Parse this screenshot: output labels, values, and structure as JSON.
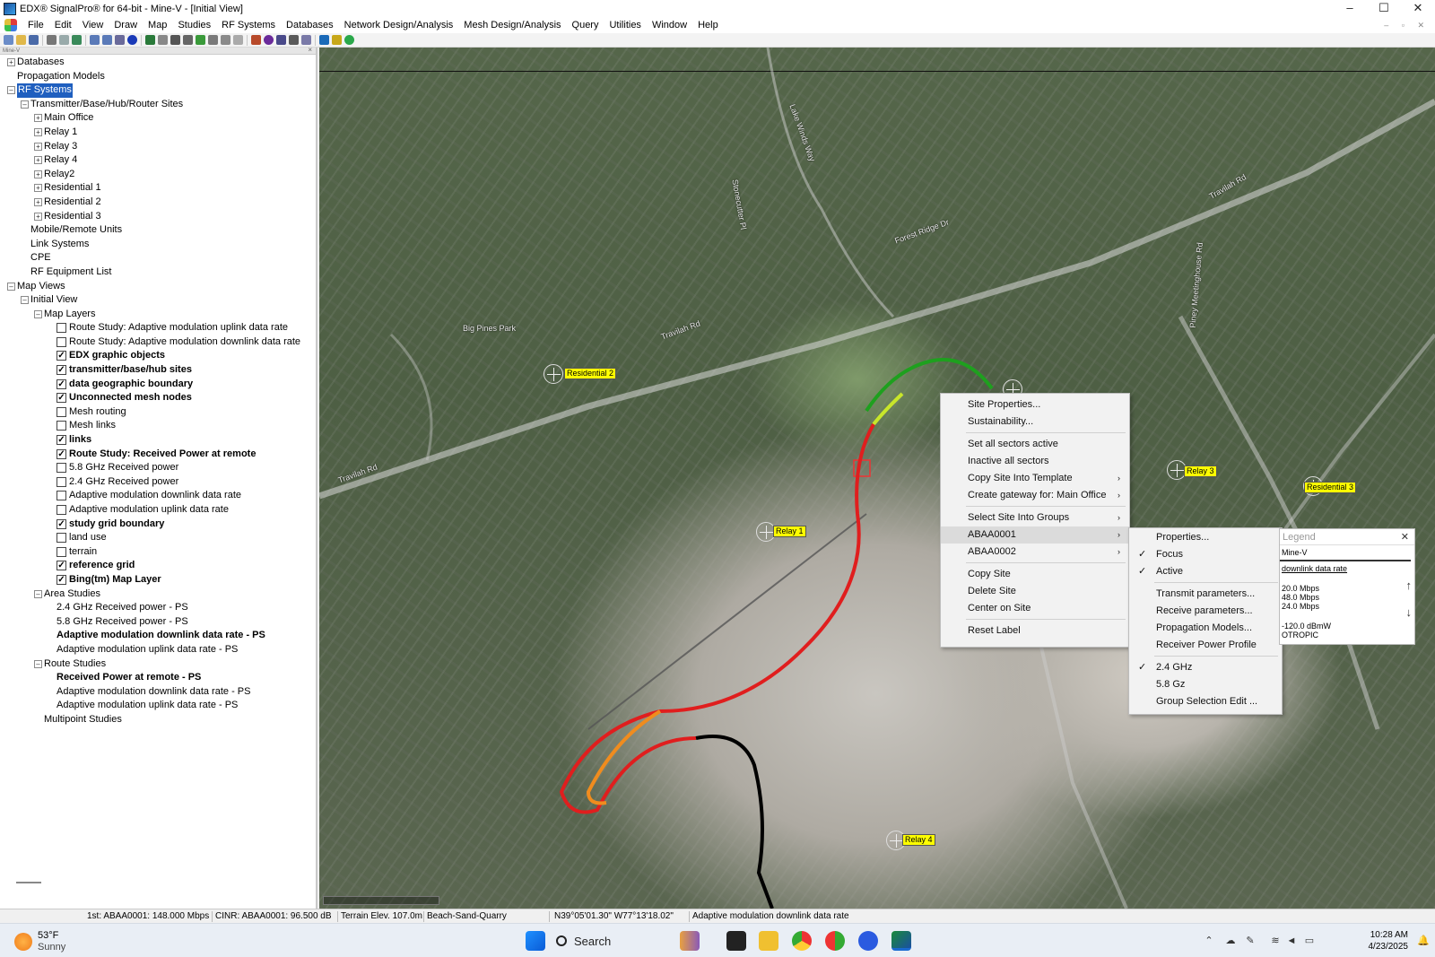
{
  "window": {
    "title": "EDX® SignalPro®  for 64-bit - Mine-V - [Initial View]",
    "controls": [
      "–",
      "☐",
      "✕"
    ]
  },
  "menubar": {
    "items": [
      "File",
      "Edit",
      "View",
      "Draw",
      "Map",
      "Studies",
      "RF Systems",
      "Databases",
      "Network Design/Analysis",
      "Mesh Design/Analysis",
      "Query",
      "Utilities",
      "Window",
      "Help"
    ]
  },
  "left_panel": {
    "header": "Mine-V",
    "close": "×",
    "tree": [
      {
        "label": "Databases",
        "indent": 0,
        "exp": "+"
      },
      {
        "label": "Propagation Models",
        "indent": 0
      },
      {
        "label": "RF Systems",
        "indent": 0,
        "exp": "–",
        "selected": true
      },
      {
        "label": "Transmitter/Base/Hub/Router Sites",
        "indent": 1,
        "exp": "–"
      },
      {
        "label": "Main Office",
        "indent": 2,
        "exp": "+"
      },
      {
        "label": "Relay 1",
        "indent": 2,
        "exp": "+"
      },
      {
        "label": "Relay 3",
        "indent": 2,
        "exp": "+"
      },
      {
        "label": "Relay 4",
        "indent": 2,
        "exp": "+"
      },
      {
        "label": "Relay2",
        "indent": 2,
        "exp": "+"
      },
      {
        "label": "Residential 1",
        "indent": 2,
        "exp": "+"
      },
      {
        "label": "Residential 2",
        "indent": 2,
        "exp": "+"
      },
      {
        "label": "Residential 3",
        "indent": 2,
        "exp": "+"
      },
      {
        "label": "Mobile/Remote Units",
        "indent": 1
      },
      {
        "label": "Link Systems",
        "indent": 1
      },
      {
        "label": "CPE",
        "indent": 1
      },
      {
        "label": "RF Equipment List",
        "indent": 1
      },
      {
        "label": "Map Views",
        "indent": 0,
        "exp": "–"
      },
      {
        "label": "Initial View",
        "indent": 1,
        "exp": "–"
      },
      {
        "label": "Map Layers",
        "indent": 2,
        "exp": "–"
      },
      {
        "label": "Route Study: Adaptive modulation uplink data rate",
        "indent": 3,
        "cb": false
      },
      {
        "label": "Route Study: Adaptive modulation downlink data rate",
        "indent": 3,
        "cb": false
      },
      {
        "label": "EDX graphic objects",
        "indent": 3,
        "cb": true,
        "bold": true
      },
      {
        "label": "transmitter/base/hub sites",
        "indent": 3,
        "cb": true,
        "bold": true
      },
      {
        "label": "data geographic boundary",
        "indent": 3,
        "cb": true,
        "bold": true
      },
      {
        "label": "Unconnected mesh nodes",
        "indent": 3,
        "cb": true,
        "bold": true
      },
      {
        "label": "Mesh routing",
        "indent": 3,
        "cb": false
      },
      {
        "label": "Mesh links",
        "indent": 3,
        "cb": false
      },
      {
        "label": "links",
        "indent": 3,
        "cb": true,
        "bold": true
      },
      {
        "label": "Route Study: Received Power at remote",
        "indent": 3,
        "cb": true,
        "bold": true
      },
      {
        "label": "5.8 GHz Received power",
        "indent": 3,
        "cb": false
      },
      {
        "label": "2.4 GHz Received power",
        "indent": 3,
        "cb": false
      },
      {
        "label": "Adaptive modulation downlink data rate",
        "indent": 3,
        "cb": false
      },
      {
        "label": "Adaptive modulation uplink data rate",
        "indent": 3,
        "cb": false
      },
      {
        "label": "study grid boundary",
        "indent": 3,
        "cb": true,
        "bold": true
      },
      {
        "label": "land use",
        "indent": 3,
        "cb": false
      },
      {
        "label": "terrain",
        "indent": 3,
        "cb": false
      },
      {
        "label": "reference grid",
        "indent": 3,
        "cb": true,
        "bold": true
      },
      {
        "label": "Bing(tm) Map Layer",
        "indent": 3,
        "cb": true,
        "bold": true
      },
      {
        "label": "Area Studies",
        "indent": 2,
        "exp": "–"
      },
      {
        "label": "2.4 GHz Received power - PS",
        "indent": 3
      },
      {
        "label": "5.8 GHz Received power - PS",
        "indent": 3
      },
      {
        "label": "Adaptive modulation downlink data rate - PS",
        "indent": 3,
        "bold": true
      },
      {
        "label": "Adaptive modulation uplink data rate - PS",
        "indent": 3
      },
      {
        "label": "Route Studies",
        "indent": 2,
        "exp": "–"
      },
      {
        "label": "Received Power at remote - PS",
        "indent": 3,
        "bold": true
      },
      {
        "label": "Adaptive modulation downlink data rate - PS",
        "indent": 3
      },
      {
        "label": "Adaptive modulation uplink data rate - PS",
        "indent": 3
      },
      {
        "label": "Multipoint Studies",
        "indent": 2
      }
    ]
  },
  "map": {
    "site_labels": [
      {
        "id": "residential-2",
        "label": "Residential 2"
      },
      {
        "id": "relay-1",
        "label": "Relay 1"
      },
      {
        "id": "relay-3",
        "label": "Relay 3"
      },
      {
        "id": "residential-3",
        "label": "Residential 3"
      },
      {
        "id": "relay-4",
        "label": "Relay 4"
      },
      {
        "id": "main-office",
        "label": "Main Office"
      }
    ],
    "street_labels": [
      "Travilah Rd",
      "Travilah Rd",
      "Travilah Rd",
      "Big Pines Park",
      "Lake Winds Way",
      "Forest Ridge Dr",
      "Piney Meetinghouse Rd",
      "Stonecutter Pl"
    ],
    "route_colors": {
      "good": "#1ea01e",
      "fair": "#c8e62a",
      "warn": "#f08c1e",
      "bad": "#e01e1e",
      "none": "#000000"
    }
  },
  "context_menu": {
    "items": [
      {
        "label": "Site Properties..."
      },
      {
        "label": "Sustainability..."
      },
      {
        "sep": true
      },
      {
        "label": "Set all sectors active"
      },
      {
        "label": "Inactive all sectors"
      },
      {
        "label": "Copy Site Into Template",
        "arrow": true
      },
      {
        "label": "Create gateway for: Main Office",
        "arrow": true
      },
      {
        "sep": true
      },
      {
        "label": "Select Site Into Groups",
        "arrow": true
      },
      {
        "label": "ABAA0001",
        "arrow": true,
        "highlight": true
      },
      {
        "label": "ABAA0002",
        "arrow": true
      },
      {
        "sep": true
      },
      {
        "label": "Copy Site"
      },
      {
        "label": "Delete Site"
      },
      {
        "label": "Center on Site"
      },
      {
        "sep": true
      },
      {
        "label": "Reset Label"
      }
    ],
    "arrow_glyph": "›"
  },
  "sub_menu": {
    "items": [
      {
        "label": "Properties..."
      },
      {
        "label": "Focus",
        "checked": true
      },
      {
        "label": "Active",
        "checked": true
      },
      {
        "sep": true
      },
      {
        "label": "Transmit parameters..."
      },
      {
        "label": "Receive parameters..."
      },
      {
        "label": "Propagation Models..."
      },
      {
        "label": "Receiver Power Profile"
      },
      {
        "sep": true
      },
      {
        "label": "2.4 GHz",
        "checked": true
      },
      {
        "label": "5.8 Gz"
      },
      {
        "label": "Group Selection Edit ..."
      }
    ],
    "check_glyph": "✓"
  },
  "legend": {
    "title": "Legend",
    "close": "✕",
    "lines": [
      "Mine-V",
      "downlink data rate",
      "20.0 Mbps",
      "48.0 Mbps",
      "24.0 Mbps",
      "-120.0 dBmW",
      "OTROPIC"
    ],
    "arrows": [
      "↑",
      "↓"
    ]
  },
  "statusbar": {
    "fields": [
      "1st: ABAA0001: 148.000 Mbps",
      "CINR: ABAA0001: 96.500 dB",
      "Terrain Elev. 107.0m",
      "Beach-Sand-Quarry",
      "N39°05'01.30\" W77°13'18.02\"",
      "Adaptive modulation downlink data rate"
    ]
  },
  "taskbar": {
    "weather_temp": "53°F",
    "weather_cond": "Sunny",
    "search_label": "Search",
    "time": "10:28 AM",
    "date": "4/23/2025",
    "tray_up": "⌃",
    "bell": "🔔"
  }
}
